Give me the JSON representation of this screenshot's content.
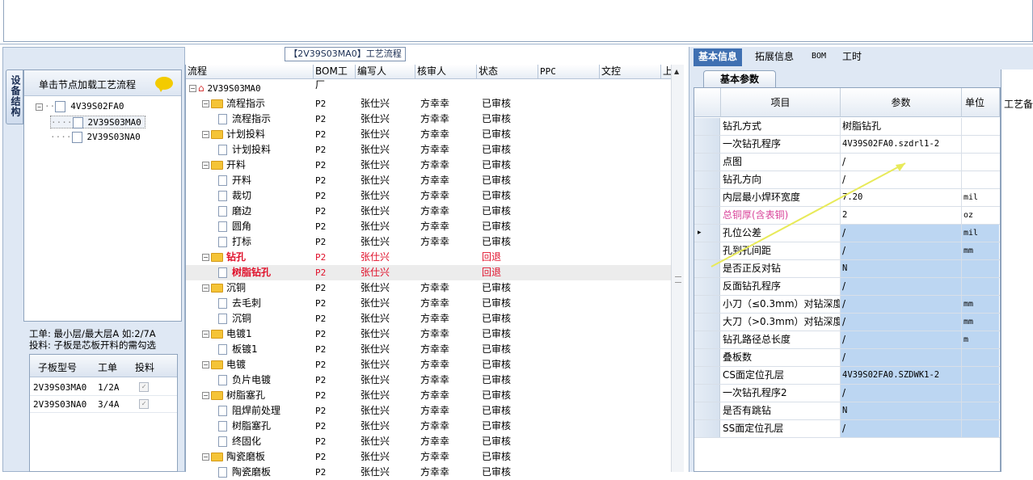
{
  "left": {
    "side_tab": "设备结构",
    "load_label": "单击节点加载工艺流程",
    "tree": [
      {
        "label": "4V39S02FA0"
      },
      {
        "label": "2V39S03MA0"
      },
      {
        "label": "2V39S03NA0"
      }
    ],
    "info_line1": "工单: 最小层/最大层A 如:2/7A",
    "info_line2": "投料: 子板是芯板开料的需勾选",
    "sub_headers": [
      "子板型号",
      "工单",
      "投料"
    ],
    "sub_rows": [
      {
        "model": "2V39S03MA0",
        "order": "1/2A"
      },
      {
        "model": "2V39S03NA0",
        "order": "3/4A"
      }
    ]
  },
  "center": {
    "title": "【2V39S03MA0】工艺流程",
    "headers": [
      "流程",
      "BOM工厂",
      "编写人",
      "核审人",
      "状态",
      "PPC",
      "文控",
      "上"
    ],
    "root": "2V39S03MA0",
    "rows": [
      {
        "name": "流程指示",
        "level": 1,
        "bom": "P2",
        "writer": "张仕兴",
        "reviewer": "方幸幸",
        "status": "已审核"
      },
      {
        "name": "流程指示",
        "level": 2,
        "bom": "P2",
        "writer": "张仕兴",
        "reviewer": "方幸幸",
        "status": "已审核"
      },
      {
        "name": "计划投料",
        "level": 1,
        "bom": "P2",
        "writer": "张仕兴",
        "reviewer": "方幸幸",
        "status": "已审核"
      },
      {
        "name": "计划投料",
        "level": 2,
        "bom": "P2",
        "writer": "张仕兴",
        "reviewer": "方幸幸",
        "status": "已审核"
      },
      {
        "name": "开料",
        "level": 1,
        "bom": "P2",
        "writer": "张仕兴",
        "reviewer": "方幸幸",
        "status": "已审核"
      },
      {
        "name": "开料",
        "level": 2,
        "bom": "P2",
        "writer": "张仕兴",
        "reviewer": "方幸幸",
        "status": "已审核"
      },
      {
        "name": "裁切",
        "level": 2,
        "bom": "P2",
        "writer": "张仕兴",
        "reviewer": "方幸幸",
        "status": "已审核"
      },
      {
        "name": "磨边",
        "level": 2,
        "bom": "P2",
        "writer": "张仕兴",
        "reviewer": "方幸幸",
        "status": "已审核"
      },
      {
        "name": "圆角",
        "level": 2,
        "bom": "P2",
        "writer": "张仕兴",
        "reviewer": "方幸幸",
        "status": "已审核"
      },
      {
        "name": "打标",
        "level": 2,
        "bom": "P2",
        "writer": "张仕兴",
        "reviewer": "方幸幸",
        "status": "已审核"
      },
      {
        "name": "钻孔",
        "level": 1,
        "bom": "P2",
        "writer": "张仕兴",
        "reviewer": "",
        "status": "回退",
        "red": true
      },
      {
        "name": "树脂钻孔",
        "level": 2,
        "bom": "P2",
        "writer": "张仕兴",
        "reviewer": "",
        "status": "回退",
        "red": true,
        "selected": true
      },
      {
        "name": "沉铜",
        "level": 1,
        "bom": "P2",
        "writer": "张仕兴",
        "reviewer": "方幸幸",
        "status": "已审核"
      },
      {
        "name": "去毛刺",
        "level": 2,
        "bom": "P2",
        "writer": "张仕兴",
        "reviewer": "方幸幸",
        "status": "已审核"
      },
      {
        "name": "沉铜",
        "level": 2,
        "bom": "P2",
        "writer": "张仕兴",
        "reviewer": "方幸幸",
        "status": "已审核"
      },
      {
        "name": "电镀1",
        "level": 1,
        "bom": "P2",
        "writer": "张仕兴",
        "reviewer": "方幸幸",
        "status": "已审核"
      },
      {
        "name": "板镀1",
        "level": 2,
        "bom": "P2",
        "writer": "张仕兴",
        "reviewer": "方幸幸",
        "status": "已审核"
      },
      {
        "name": "电镀",
        "level": 1,
        "bom": "P2",
        "writer": "张仕兴",
        "reviewer": "方幸幸",
        "status": "已审核"
      },
      {
        "name": "负片电镀",
        "level": 2,
        "bom": "P2",
        "writer": "张仕兴",
        "reviewer": "方幸幸",
        "status": "已审核"
      },
      {
        "name": "树脂塞孔",
        "level": 1,
        "bom": "P2",
        "writer": "张仕兴",
        "reviewer": "方幸幸",
        "status": "已审核"
      },
      {
        "name": "阻焊前处理",
        "level": 2,
        "bom": "P2",
        "writer": "张仕兴",
        "reviewer": "方幸幸",
        "status": "已审核"
      },
      {
        "name": "树脂塞孔",
        "level": 2,
        "bom": "P2",
        "writer": "张仕兴",
        "reviewer": "方幸幸",
        "status": "已审核"
      },
      {
        "name": "终固化",
        "level": 2,
        "bom": "P2",
        "writer": "张仕兴",
        "reviewer": "方幸幸",
        "status": "已审核"
      },
      {
        "name": "陶瓷磨板",
        "level": 1,
        "bom": "P2",
        "writer": "张仕兴",
        "reviewer": "方幸幸",
        "status": "已审核"
      },
      {
        "name": "陶瓷磨板",
        "level": 2,
        "bom": "P2",
        "writer": "张仕兴",
        "reviewer": "方幸幸",
        "status": "已审核"
      }
    ]
  },
  "right": {
    "tabs": [
      "基本信息",
      "拓展信息",
      "BOM",
      "工时"
    ],
    "subtab": "基本参数",
    "headers": [
      "项目",
      "参数",
      "单位"
    ],
    "strip_label": "工艺备",
    "rows": [
      {
        "item": "钻孔方式",
        "param": "树脂钻孔",
        "unit": ""
      },
      {
        "item": "一次钻孔程序",
        "param": "4V39S02FA0.szdrl1-2",
        "unit": ""
      },
      {
        "item": "点图",
        "param": "/",
        "unit": ""
      },
      {
        "item": "钻孔方向",
        "param": "/",
        "unit": ""
      },
      {
        "item": "内层最小焊环宽度",
        "param": "7.20",
        "unit": "mil"
      },
      {
        "item": "总铜厚(含表铜)",
        "param": "2",
        "unit": "oz",
        "pink": true
      },
      {
        "item": "孔位公差",
        "param": "/",
        "unit": "mil",
        "current": true
      },
      {
        "item": "孔到孔间距",
        "param": "/",
        "unit": "mm"
      },
      {
        "item": "是否正反对钻",
        "param": "N",
        "unit": ""
      },
      {
        "item": "反面钻孔程序",
        "param": "/",
        "unit": ""
      },
      {
        "item": "小刀（≤0.3mm）对钻深度",
        "param": "/",
        "unit": "mm"
      },
      {
        "item": "大刀（>0.3mm）对钻深度",
        "param": "/",
        "unit": "mm"
      },
      {
        "item": "钻孔路径总长度",
        "param": "/",
        "unit": "m"
      },
      {
        "item": "叠板数",
        "param": "/",
        "unit": ""
      },
      {
        "item": "CS面定位孔层",
        "param": "4V39S02FA0.SZDWK1-2",
        "unit": ""
      },
      {
        "item": "一次钻孔程序2",
        "param": "/",
        "unit": ""
      },
      {
        "item": "是否有跳钻",
        "param": "N",
        "unit": ""
      },
      {
        "item": "SS面定位孔层",
        "param": "/",
        "unit": ""
      }
    ]
  }
}
